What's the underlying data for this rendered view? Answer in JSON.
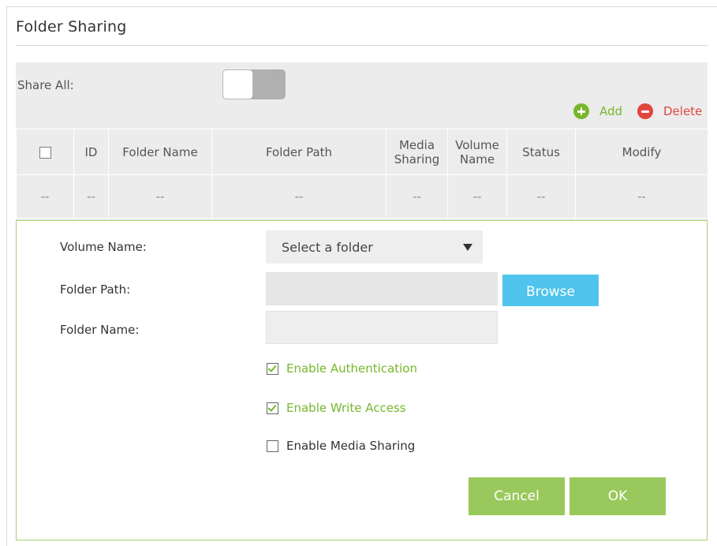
{
  "section": {
    "title": "Folder Sharing"
  },
  "share_all": {
    "label": "Share All:",
    "enabled": false
  },
  "actions": {
    "add": "Add",
    "delete": "Delete"
  },
  "table": {
    "columns": [
      "ID",
      "Folder Name",
      "Folder Path",
      "Media Sharing",
      "Volume Name",
      "Status",
      "Modify"
    ],
    "rows": [
      [
        "--",
        "--",
        "--",
        "--",
        "--",
        "--",
        "--",
        "--"
      ]
    ]
  },
  "form": {
    "volume_name": {
      "label": "Volume Name:",
      "value": "Select a folder"
    },
    "folder_path": {
      "label": "Folder Path:",
      "value": "",
      "browse": "Browse"
    },
    "folder_name": {
      "label": "Folder Name:",
      "value": ""
    },
    "options": [
      {
        "label": "Enable Authentication",
        "checked": true
      },
      {
        "label": "Enable Write Access",
        "checked": true
      },
      {
        "label": "Enable Media Sharing",
        "checked": false
      }
    ],
    "cancel": "Cancel",
    "ok": "OK"
  },
  "colors": {
    "accent_green": "#77b72d",
    "button_green": "#99c95c",
    "browse_blue": "#4fc4ec",
    "delete_red": "#e0463e",
    "panel_gray": "#ececec"
  }
}
